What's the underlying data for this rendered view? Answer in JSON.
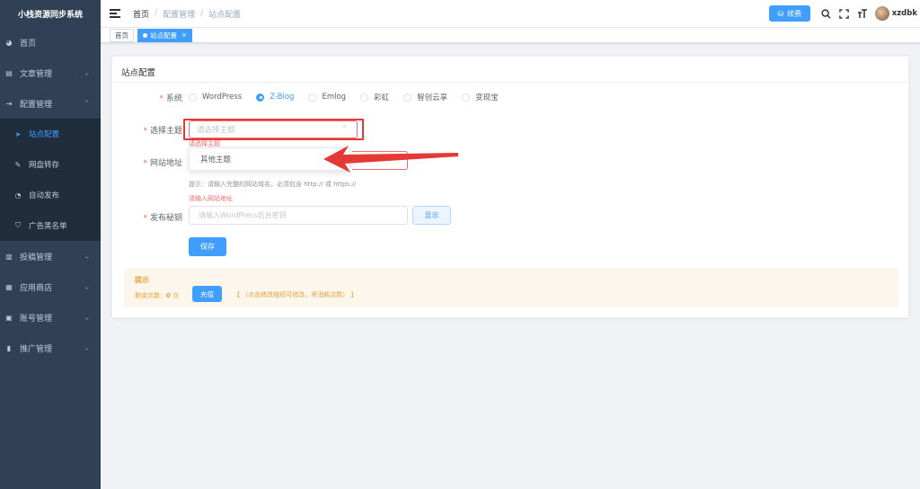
{
  "app": {
    "title": "小栈资源同步系统"
  },
  "sidebar": {
    "items": [
      {
        "label": "首页",
        "icon": "dashboard-icon",
        "has_children": false
      },
      {
        "label": "文章管理",
        "icon": "document-icon",
        "has_children": true
      },
      {
        "label": "配置管理",
        "icon": "config-icon",
        "has_children": true,
        "expanded": true,
        "children": [
          {
            "label": "站点配置",
            "icon": "send-icon",
            "active": true
          },
          {
            "label": "网盘转存",
            "icon": "edit-icon"
          },
          {
            "label": "自动发布",
            "icon": "schedule-icon"
          },
          {
            "label": "广告黑名单",
            "icon": "shield-icon"
          }
        ]
      },
      {
        "label": "投稿管理",
        "icon": "bar-chart-icon",
        "has_children": true
      },
      {
        "label": "应用商店",
        "icon": "store-icon",
        "has_children": true
      },
      {
        "label": "账号管理",
        "icon": "account-icon",
        "has_children": true
      },
      {
        "label": "推广管理",
        "icon": "promote-icon",
        "has_children": true
      }
    ]
  },
  "header": {
    "breadcrumb": [
      "首页",
      "配置管理",
      "站点配置"
    ],
    "renew_label": "续费",
    "username": "xzdbk"
  },
  "tags": [
    {
      "label": "首页",
      "active": false
    },
    {
      "label": "站点配置",
      "active": true,
      "close": "×"
    }
  ],
  "card": {
    "title": "站点配置",
    "form": {
      "system_label": "系统",
      "systems": [
        {
          "label": "WordPress",
          "checked": false
        },
        {
          "label": "Z-Blog",
          "checked": true
        },
        {
          "label": "Emlog",
          "checked": false
        },
        {
          "label": "彩虹",
          "checked": false
        },
        {
          "label": "智创云享",
          "checked": false
        },
        {
          "label": "变现宝",
          "checked": false
        }
      ],
      "theme_label": "选择主题",
      "theme_placeholder": "请选择主题",
      "theme_error": "请选择主题",
      "theme_option": "其他主题",
      "url_label": "网站地址",
      "url_hint": "提示：请输入完整的网站域名，必须包含 http:// 或 https://",
      "url_error": "请输入网站地址",
      "key_label": "发布秘钥",
      "key_placeholder": "请输入WordPress后台密钥",
      "show_label": "显示",
      "save_label": "保存"
    }
  },
  "tip": {
    "title": "提示",
    "remain_label": "剩余次数：",
    "remain_value": "0",
    "remain_unit": " 次",
    "recharge_label": "充值",
    "note": "【 （点击修改按钮可修改，将消耗次数） 】"
  },
  "colors": {
    "primary": "#409eff",
    "sidebar_bg": "#304156",
    "error": "#f56c6c",
    "warning": "#e6a23c",
    "annotation": "#e53935"
  }
}
